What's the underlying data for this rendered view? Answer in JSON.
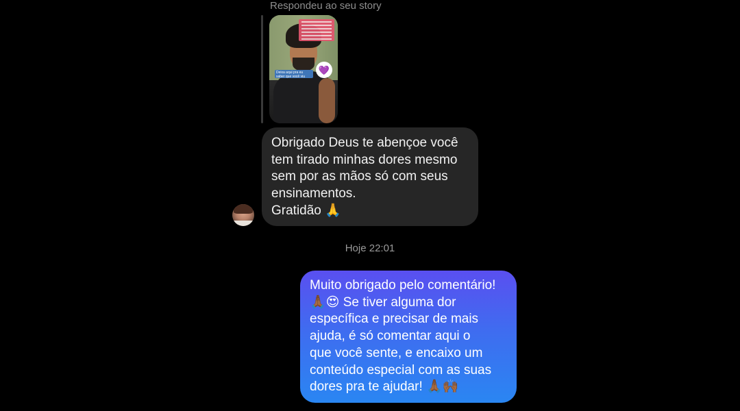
{
  "conversation": {
    "story_reply_label": "Respondeu ao seu story",
    "story": {
      "caption_bottom": "Deixa aqui pra eu saber que você viu",
      "heart_icon": "purple-heart"
    },
    "incoming_message": {
      "text": "Obrigado Deus te abençoe você\ntem tirado minhas dores mesmo\nsem por as mãos só com seus\nensinamentos.\nGratidão 🙏"
    },
    "timestamp": "Hoje 22:01",
    "outgoing_message": {
      "text": "Muito obrigado pelo comentário!\n🙏🏾😍 Se tiver alguma dor\nespecífica e precisar de mais\najuda, é só comentar aqui o\nque você sente, e encaixo um\nconteúdo especial com as suas\ndores pra te ajudar! 🙏🏾🙌🏾"
    }
  },
  "colors": {
    "background": "#000000",
    "incoming_bubble": "#262626",
    "outgoing_gradient_top": "#5a4ff0",
    "outgoing_gradient_bottom": "#2a86f2",
    "meta_text": "#8e8e8e"
  }
}
